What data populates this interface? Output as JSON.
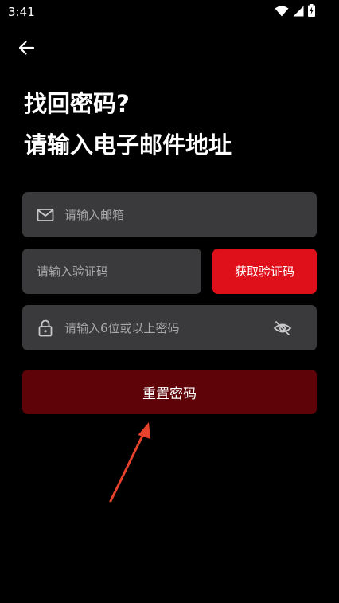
{
  "status_bar": {
    "time": "3:41",
    "icons": [
      "wifi-icon",
      "signal-icon",
      "battery-icon"
    ]
  },
  "header": {
    "back_icon": "arrow-left-icon"
  },
  "title": {
    "line1": "找回密码?",
    "line2": "请输入电子邮件地址"
  },
  "form": {
    "email": {
      "icon": "mail-icon",
      "value": "",
      "placeholder": "请输入邮箱"
    },
    "code": {
      "value": "",
      "placeholder": "请输入验证码"
    },
    "get_code_label": "获取验证码",
    "password": {
      "icon": "lock-icon",
      "value": "",
      "placeholder": "请输入6位或以上密码",
      "toggle_icon": "eye-off-icon"
    },
    "reset_label": "重置密码"
  },
  "colors": {
    "background": "#000000",
    "field": "#3a3a3c",
    "accent": "#e0101b",
    "reset_button": "#5e0409",
    "annotation_arrow": "#e8412c"
  }
}
